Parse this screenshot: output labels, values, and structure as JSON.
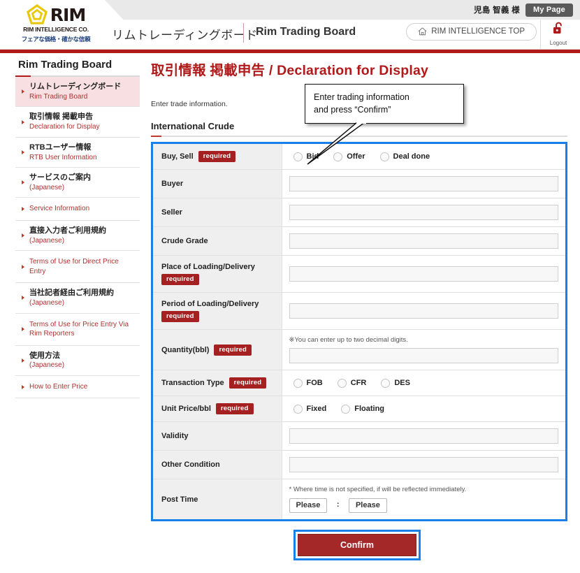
{
  "header": {
    "user_name": "児島 智義 様",
    "my_page_label": "My Page",
    "logo_rim": "RIM",
    "logo_company": "RIM INTELLIGENCE CO.",
    "logo_tagline": "フェアな価格・確かな信頼",
    "brand_jp": "リムトレーディングボード",
    "brand_en": "Rim Trading Board",
    "top_button_label": "RIM INTELLIGENCE TOP",
    "logout_label": "Logout",
    "accent_red": "#b01a1a"
  },
  "sidebar": {
    "title": "Rim Trading Board",
    "items": [
      {
        "jp": "リムトレーディングボード",
        "en": "Rim Trading Board",
        "active": true
      },
      {
        "jp": "取引情報 掲載申告",
        "en": "Declaration for Display",
        "active": false
      },
      {
        "jp": "RTBユーザー情報",
        "en": "RTB User Information",
        "active": false
      },
      {
        "jp": "サービスのご案内",
        "en": "(Japanese)",
        "active": false
      },
      {
        "jp": "",
        "en": "Service Information",
        "active": false
      },
      {
        "jp": "直接入力者ご利用規約",
        "en": "(Japanese)",
        "active": false
      },
      {
        "jp": "",
        "en": "Terms of Use for Direct Price Entry",
        "active": false
      },
      {
        "jp": "当社記者経由ご利用規約",
        "en": "(Japanese)",
        "active": false
      },
      {
        "jp": "",
        "en": "Terms of Use for Price Entry Via Rim Reporters",
        "active": false
      },
      {
        "jp": "使用方法",
        "en": "(Japanese)",
        "active": false
      },
      {
        "jp": "",
        "en": "How to Enter Price",
        "active": false
      }
    ]
  },
  "main": {
    "title": "取引情報 掲載申告 / Declaration for Display",
    "lead": "Enter trade information.",
    "section_heading": "International Crude",
    "callout_line1": "Enter trading information",
    "callout_line2": "and press “Confirm”",
    "required_badge": "required",
    "confirm_label": "Confirm",
    "highlight_color": "#1a7fe8"
  },
  "form": {
    "rows": [
      {
        "label": "Buy, Sell",
        "required": true,
        "required_inline": true,
        "type": "radio",
        "options": [
          "Bid",
          "Offer",
          "Deal done"
        ]
      },
      {
        "label": "Buyer",
        "required": false,
        "type": "text",
        "value": "",
        "placeholder": ""
      },
      {
        "label": "Seller",
        "required": false,
        "type": "text",
        "value": "",
        "placeholder": ""
      },
      {
        "label": "Crude Grade",
        "required": false,
        "type": "text",
        "value": "",
        "placeholder": ""
      },
      {
        "label": "Place of Loading/Delivery",
        "required": true,
        "required_inline": false,
        "type": "text",
        "value": "",
        "placeholder": ""
      },
      {
        "label": "Period of Loading/Delivery",
        "required": true,
        "required_inline": false,
        "type": "text",
        "value": "",
        "placeholder": ""
      },
      {
        "label": "Quantity(bbl)",
        "required": true,
        "required_inline": true,
        "type": "text-note",
        "value": "",
        "placeholder": "",
        "note": "※You can enter up to two decimal digits."
      },
      {
        "label": "Transaction Type",
        "required": true,
        "required_inline": true,
        "type": "radio",
        "options": [
          "FOB",
          "CFR",
          "DES"
        ]
      },
      {
        "label": "Unit Price/bbl",
        "required": true,
        "required_inline": true,
        "type": "radio",
        "options": [
          "Fixed",
          "Floating"
        ]
      },
      {
        "label": "Validity",
        "required": false,
        "type": "text",
        "value": "",
        "placeholder": ""
      },
      {
        "label": "Other Condition",
        "required": false,
        "type": "text",
        "value": "",
        "placeholder": ""
      },
      {
        "label": "Post Time",
        "required": false,
        "type": "time",
        "note": "* Where time is not specified, if will be reflected immediately.",
        "hour_value": "Please",
        "minute_value": "Please",
        "separator": ":"
      }
    ]
  }
}
